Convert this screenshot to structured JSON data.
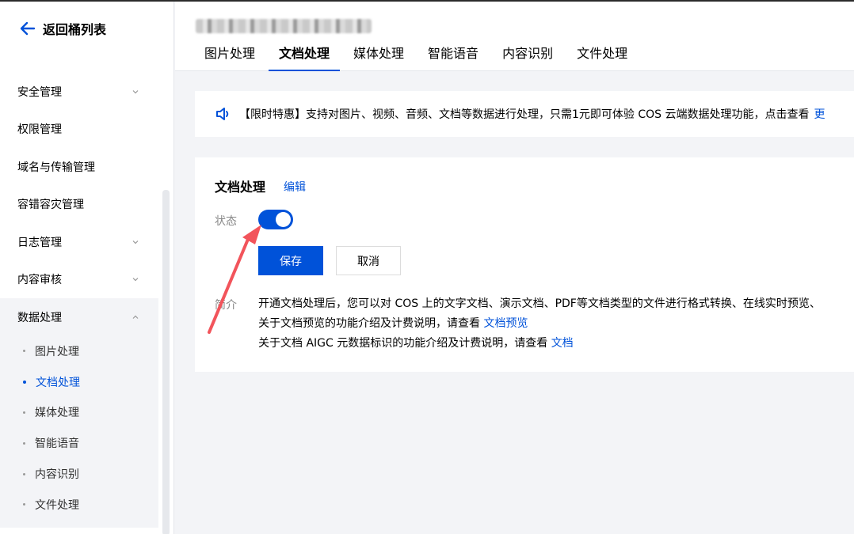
{
  "sidebar": {
    "back_label": "返回桶列表",
    "menu": [
      {
        "label": "安全管理",
        "chevron": "down"
      },
      {
        "label": "权限管理",
        "chevron": ""
      },
      {
        "label": "域名与传输管理",
        "chevron": ""
      },
      {
        "label": "容错容灾管理",
        "chevron": ""
      },
      {
        "label": "日志管理",
        "chevron": "down"
      },
      {
        "label": "内容审核",
        "chevron": "down"
      },
      {
        "label": "数据处理",
        "chevron": "up"
      }
    ],
    "submenu": [
      {
        "label": "图片处理",
        "active": false
      },
      {
        "label": "文档处理",
        "active": true
      },
      {
        "label": "媒体处理",
        "active": false
      },
      {
        "label": "智能语音",
        "active": false
      },
      {
        "label": "内容识别",
        "active": false
      },
      {
        "label": "文件处理",
        "active": false
      }
    ]
  },
  "header": {
    "tabs": [
      {
        "label": "图片处理",
        "active": false
      },
      {
        "label": "文档处理",
        "active": true
      },
      {
        "label": "媒体处理",
        "active": false
      },
      {
        "label": "智能语音",
        "active": false
      },
      {
        "label": "内容识别",
        "active": false
      },
      {
        "label": "文件处理",
        "active": false
      }
    ]
  },
  "notice": {
    "icon": "speaker-icon",
    "text": "【限时特惠】支持对图片、视频、音频、文档等数据进行处理，只需1元即可体验 COS 云端数据处理功能，点击查看",
    "link": "更"
  },
  "card": {
    "title": "文档处理",
    "edit_label": "编辑",
    "status_label": "状态",
    "status_on": true,
    "save_label": "保存",
    "cancel_label": "取消",
    "intro_label": "简介",
    "intro_line1": "开通文档处理后，您可以对 COS 上的文字文档、演示文档、PDF等文档类型的文件进行格式转换、在线实时预览、",
    "intro_line2_text": "关于文档预览的功能介绍及计费说明，请查看 ",
    "intro_line2_link": "文档预览",
    "intro_line3_text": "关于文档 AIGC 元数据标识的功能介绍及计费说明，请查看 ",
    "intro_line3_link": "文档"
  },
  "colors": {
    "accent": "#0052d9",
    "annotation": "#f2545b"
  }
}
